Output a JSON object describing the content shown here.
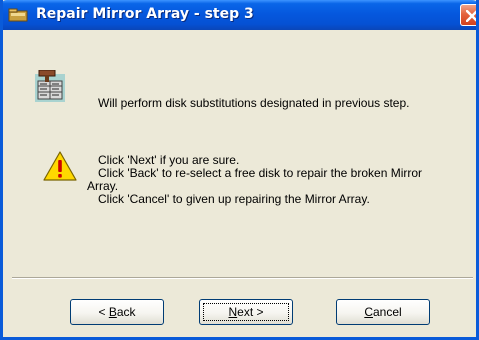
{
  "window": {
    "title": "Repair Mirror Array - step 3"
  },
  "icons": {
    "title": "disk-array-icon",
    "disk": "disk-array-icon",
    "warning": "warning-icon",
    "close": "close-icon"
  },
  "messages": {
    "info": "Will perform disk substitutions designated in previous step.",
    "warning_line1": "Click 'Next' if you are sure.",
    "warning_line2": "Click 'Back' to re-select a free disk to repair the broken Mirror",
    "warning_line3": "Array.",
    "warning_line4": "Click 'Cancel' to given up repairing the Mirror Array."
  },
  "buttons": {
    "back": {
      "prefix": "< ",
      "mnemonic": "B",
      "rest": "ack"
    },
    "next": {
      "mnemonic": "N",
      "rest": "ext >"
    },
    "cancel": {
      "mnemonic": "C",
      "rest": "ancel"
    }
  },
  "colors": {
    "titlebar": "#0558de",
    "dialog_bg": "#ece9d8",
    "close_button": "#e4643e",
    "warning_yellow": "#ffd800",
    "warning_mark": "#cc0000"
  }
}
